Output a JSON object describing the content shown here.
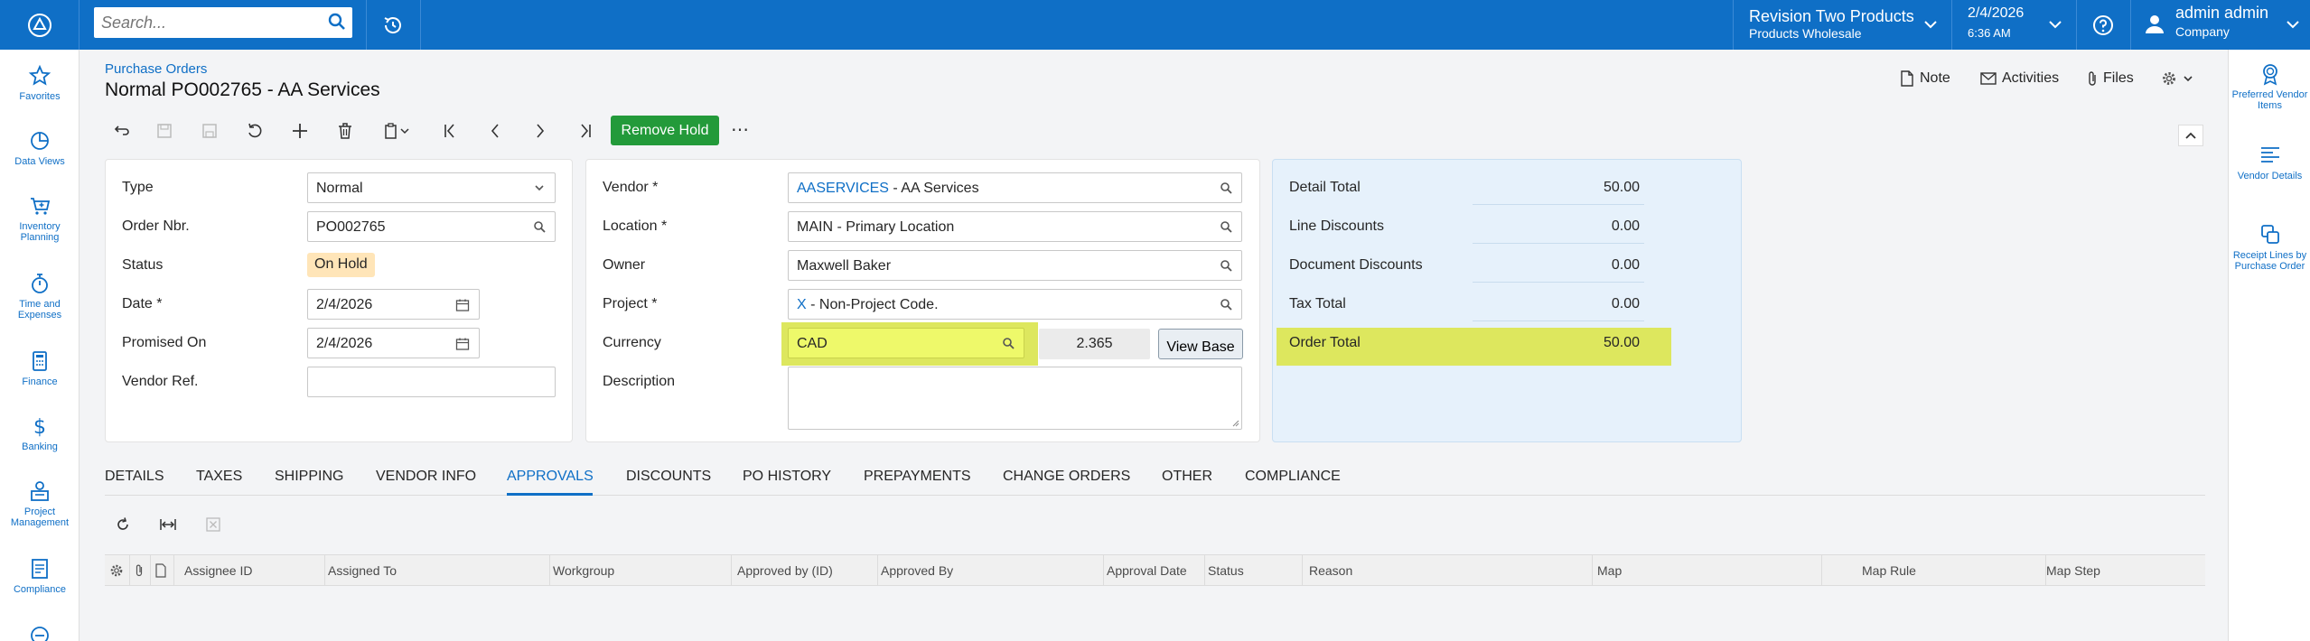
{
  "topbar": {
    "search_placeholder": "Search...",
    "company": {
      "name": "Revision Two Products",
      "branch": "Products Wholesale"
    },
    "date": {
      "date": "2/4/2026",
      "time": "6:36 AM"
    },
    "user": {
      "name": "admin admin",
      "tenant": "Company"
    },
    "accent": "#0f6fc6"
  },
  "leftnav": [
    {
      "label": "Favorites",
      "icon": "star-icon"
    },
    {
      "label": "Data Views",
      "icon": "pie-chart-icon"
    },
    {
      "label": "Inventory Planning",
      "icon": "cart-icon"
    },
    {
      "label": "Time and Expenses",
      "icon": "stopwatch-icon"
    },
    {
      "label": "Finance",
      "icon": "calculator-icon"
    },
    {
      "label": "Banking",
      "icon": "dollar-icon"
    },
    {
      "label": "Project Management",
      "icon": "person-board-icon"
    },
    {
      "label": "Compliance",
      "icon": "document-icon"
    }
  ],
  "rightrail": [
    {
      "label": "Preferred Vendor Items",
      "icon": "award-icon"
    },
    {
      "label": "Vendor Details",
      "icon": "list-details-icon"
    },
    {
      "label": "Receipt Lines by Purchase Order",
      "icon": "copy-icon"
    }
  ],
  "header": {
    "breadcrumb": "Purchase Orders",
    "title": "Normal PO002765 - AA Services",
    "actions": {
      "note": "Note",
      "activities": "Activities",
      "files": "Files"
    }
  },
  "toolbar": {
    "remove_hold": "Remove Hold",
    "more": "⋯"
  },
  "form": {
    "left": {
      "type": {
        "label": "Type",
        "value": "Normal"
      },
      "order_nbr": {
        "label": "Order Nbr.",
        "value": "PO002765"
      },
      "status": {
        "label": "Status",
        "value": "On Hold"
      },
      "date": {
        "label": "Date *",
        "value": "2/4/2026"
      },
      "promised_on": {
        "label": "Promised On",
        "value": "2/4/2026"
      },
      "vendor_ref": {
        "label": "Vendor Ref.",
        "value": ""
      }
    },
    "middle": {
      "vendor": {
        "label": "Vendor *",
        "code": "AASERVICES",
        "name": " - AA Services"
      },
      "location": {
        "label": "Location *",
        "value": "MAIN - Primary Location"
      },
      "owner": {
        "label": "Owner",
        "value": "Maxwell Baker"
      },
      "project": {
        "label": "Project *",
        "code": "X",
        "name": " - Non-Project Code."
      },
      "currency": {
        "label": "Currency",
        "value": "CAD",
        "rate": "2.365",
        "view_base": "View Base"
      },
      "description": {
        "label": "Description",
        "value": ""
      }
    },
    "totals": {
      "detail_total": {
        "label": "Detail Total",
        "value": "50.00"
      },
      "line_discounts": {
        "label": "Line Discounts",
        "value": "0.00"
      },
      "document_discounts": {
        "label": "Document Discounts",
        "value": "0.00"
      },
      "tax_total": {
        "label": "Tax Total",
        "value": "0.00"
      },
      "order_total": {
        "label": "Order Total",
        "value": "50.00"
      }
    },
    "highlight_color": "#dde75e"
  },
  "tabs": [
    "DETAILS",
    "TAXES",
    "SHIPPING",
    "VENDOR INFO",
    "APPROVALS",
    "DISCOUNTS",
    "PO HISTORY",
    "PREPAYMENTS",
    "CHANGE ORDERS",
    "OTHER",
    "COMPLIANCE"
  ],
  "active_tab": "APPROVALS",
  "grid": {
    "columns": [
      "Assignee ID",
      "Assigned To",
      "Workgroup",
      "Approved by (ID)",
      "Approved By",
      "Approval Date",
      "Status",
      "Reason",
      "Map",
      "Map Rule",
      "Map Step"
    ],
    "rows": []
  }
}
